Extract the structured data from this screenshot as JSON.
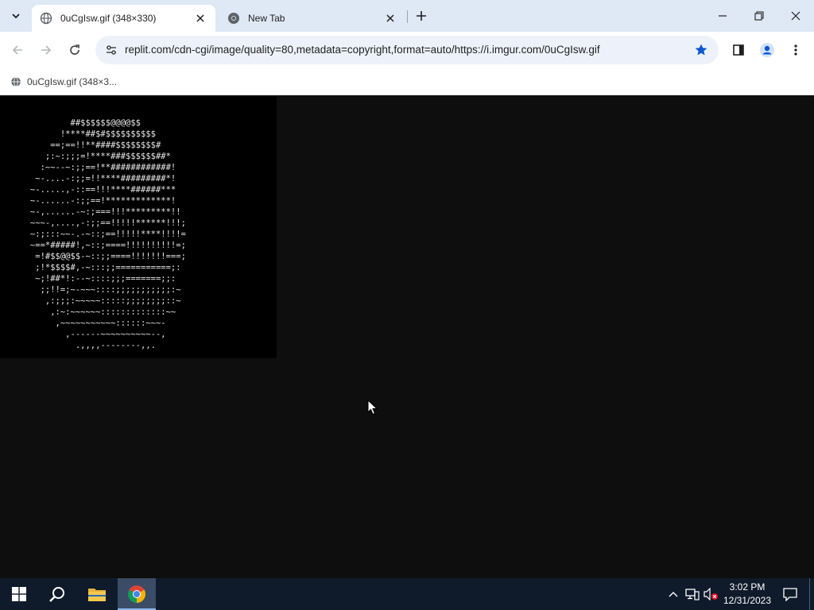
{
  "browser": {
    "tabs": [
      {
        "title": "0uCgIsw.gif (348×330)",
        "active": true,
        "icon": "globe-icon"
      },
      {
        "title": "New Tab",
        "active": false,
        "icon": "chrome-icon"
      }
    ],
    "url": "replit.com/cdn-cgi/image/quality=80,metadata=copyright,format=auto/https://i.imgur.com/0uCgIsw.gif",
    "bookmarked": true,
    "bookmarks": [
      {
        "label": "0uCgIsw.gif (348×3...",
        "icon": "globe-icon"
      }
    ]
  },
  "page": {
    "image_name": "0uCgIsw.gif",
    "ascii_art": [
      "              ##$$$$$$@@@@$$",
      "            !****##$#$$$$$$$$$$",
      "          ==;==!!**####$$$$$$$$#",
      "         ;:~:;;;=!****###$$$$$$##*",
      "        :~~--~:;;==!**############!",
      "       ~-....-:;;=!!****#########*!",
      "      ~-.....,-::==!!!****######***",
      "      ~-......-:;;==!*************!",
      "      ~-,......-~:;===!!!*********!!",
      "      ~~~-,....,-:;;==!!!!!******!!!;",
      "      ~:;:::~~-.-~::;==!!!!!****!!!!=",
      "      ~==*#####!,~::;====!!!!!!!!!!=;",
      "       =!#$$@@$$-~::;;====!!!!!!!===;",
      "       ;!*$$$$#,-~:::;;===========;:",
      "       ~;!##*!:--~::::;;;=======;;:",
      "        ;;!!=;~-~~~::::;;;;;;;;;;;:~",
      "         ,:;;;:~~~~~:::::;;;;;;;;::~",
      "          ,:~:~~~~~~:::::::::::::~~",
      "           ,~~~~~~~~~~~::::::~~~-",
      "             ,------~~~~~~~~~~--,",
      "               .,,,,--------,,."
    ]
  },
  "taskbar": {
    "items": [
      {
        "name": "start",
        "icon": "windows-icon"
      },
      {
        "name": "search",
        "icon": "search-icon"
      },
      {
        "name": "file-explorer",
        "icon": "folder-icon"
      },
      {
        "name": "chrome",
        "icon": "chrome-icon",
        "active": true
      }
    ],
    "clock": {
      "time": "3:02 PM",
      "date": "12/31/2023"
    }
  },
  "colors": {
    "tabstrip": "#dfe8f5",
    "omnibox": "#edf2fa",
    "star": "#0b57d0",
    "page_bg": "#0e0e0e",
    "taskbar": "#0f1b2b"
  }
}
